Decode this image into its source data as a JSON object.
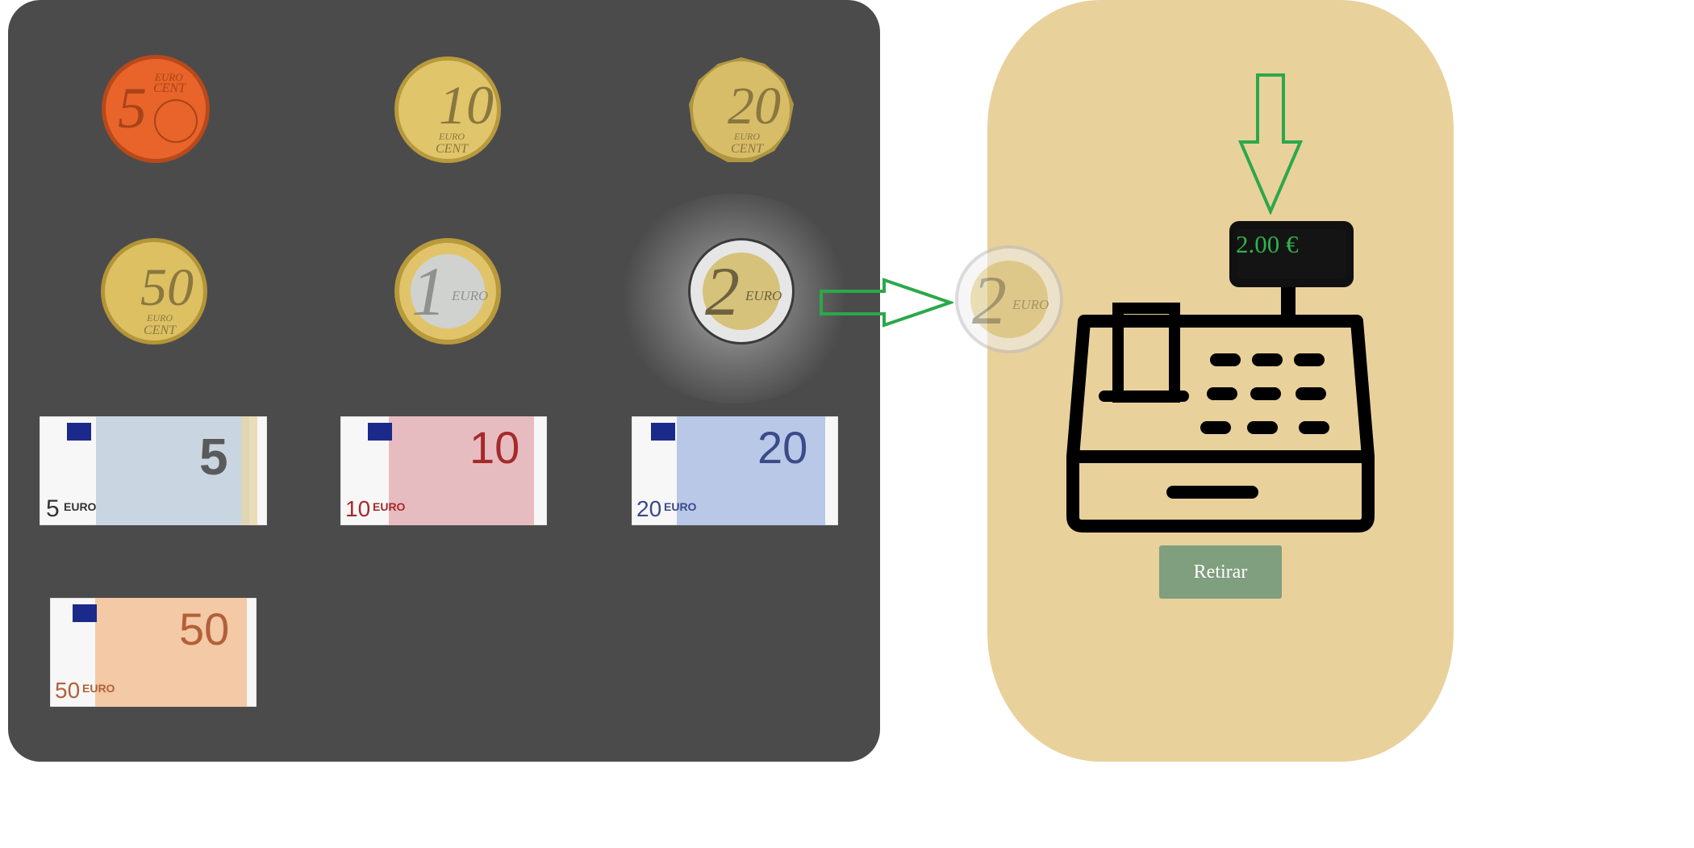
{
  "money": {
    "coins": [
      {
        "id": "coin-5c",
        "value": "5",
        "unit": "EURO",
        "sub": "CENT",
        "metal": "#e8642a",
        "rim": "#b8491a",
        "text": "#7a2d0c"
      },
      {
        "id": "coin-10c",
        "value": "10",
        "unit": "EURO",
        "sub": "CENT",
        "metal": "#e0c56a",
        "rim": "#b89a3c",
        "text": "#7a6a3a"
      },
      {
        "id": "coin-20c",
        "value": "20",
        "unit": "EURO",
        "sub": "CENT",
        "metal": "#d8bd68",
        "rim": "#b09640",
        "text": "#7a6a3a"
      },
      {
        "id": "coin-50c",
        "value": "50",
        "unit": "EURO",
        "sub": "CENT",
        "metal": "#dcc062",
        "rim": "#b39538",
        "text": "#7a6a3a"
      },
      {
        "id": "coin-1e",
        "value": "1",
        "unit": "EURO",
        "sub": "",
        "metal": "#cfd2cf",
        "rim": "#d6bb62",
        "text": "#7f7f7a"
      },
      {
        "id": "coin-2e",
        "value": "2",
        "unit": "EURO",
        "sub": "",
        "metal": "#d6c27a",
        "rim": "#e6e6e6",
        "text": "#6d6240"
      }
    ],
    "notes": [
      {
        "id": "note-5",
        "value": "5",
        "unit": "EURO",
        "tint": "#c9d6e2",
        "accent": "#5a5a5a"
      },
      {
        "id": "note-10",
        "value": "10",
        "unit": "EURO",
        "tint": "#e7bcc0",
        "accent": "#a52a2a"
      },
      {
        "id": "note-20",
        "value": "20",
        "unit": "EURO",
        "tint": "#b8c8e6",
        "accent": "#3a4a8a"
      },
      {
        "id": "note-50",
        "value": "50",
        "unit": "EURO",
        "tint": "#f4c9a6",
        "accent": "#b3603a"
      }
    ]
  },
  "register": {
    "display": "2.00 €",
    "withdraw_label": "Retirar",
    "inserted_coin": {
      "value": "2",
      "unit": "EURO"
    }
  },
  "colors": {
    "arrow": "#2ba84a",
    "panel_dark": "#4b4b4b",
    "panel_sand": "#e9d19c",
    "button": "#7f9f7f"
  }
}
